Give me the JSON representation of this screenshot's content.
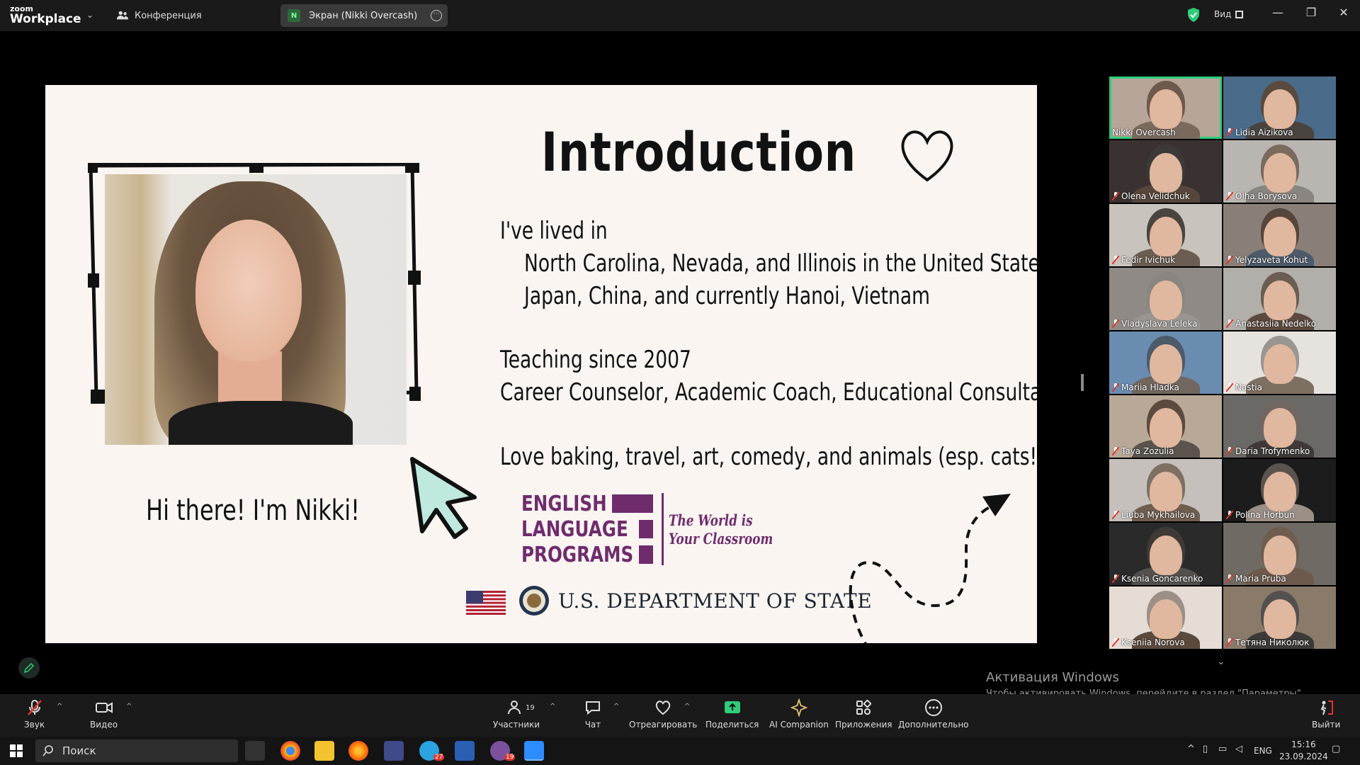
{
  "titlebar": {
    "logo_top": "zoom",
    "logo_bottom": "Workplace",
    "conference_label": "Конференция",
    "screen_tab_badge": "N",
    "screen_tab_label": "Экран (Nikki Overcash)",
    "view_label": "Вид"
  },
  "slide": {
    "title": "Introduction",
    "lived_heading": "I've lived in",
    "lived_line1": "North Carolina, Nevada, and Illinois in the United States",
    "lived_line2": "Japan, China, and currently Hanoi, Vietnam",
    "teaching": "Teaching since 2007",
    "roles": "Career Counselor, Academic Coach, Educational Consultant",
    "hobbies": "Love baking, travel, art, comedy, and animals (esp. cats!)",
    "greeting": "Hi there! I'm Nikki!",
    "elp_line1": "ENGLISH",
    "elp_line2": "LANGUAGE",
    "elp_line3": "PROGRAMS",
    "elp_tagline1": "The World is",
    "elp_tagline2": "Your Classroom",
    "dos": "U.S. DEPARTMENT OF STATE"
  },
  "participants": [
    {
      "name": "Nikki Overcash",
      "muted": false,
      "active": true
    },
    {
      "name": "Lidia Aizikova",
      "muted": true
    },
    {
      "name": "Olena Velidchuk",
      "muted": true
    },
    {
      "name": "Olha Borysova",
      "muted": true
    },
    {
      "name": "Fedir Ivichuk",
      "muted": true
    },
    {
      "name": "Yelyzaveta Kohut",
      "muted": true
    },
    {
      "name": "Vladyslava Leleka",
      "muted": true
    },
    {
      "name": "Anastasiia Nedelko",
      "muted": true
    },
    {
      "name": "Mariia Hladka",
      "muted": true
    },
    {
      "name": "Nastia",
      "muted": true
    },
    {
      "name": "Taya Zozulia",
      "muted": true
    },
    {
      "name": "Daria Trofymenko",
      "muted": true
    },
    {
      "name": "Liuba Mykhailova",
      "muted": true
    },
    {
      "name": "Polina Horbun",
      "muted": true
    },
    {
      "name": "Ksenia Goncarenko",
      "muted": true
    },
    {
      "name": "Maria Pruba",
      "muted": true
    },
    {
      "name": "Kseniia Norova",
      "muted": true
    },
    {
      "name": "Тетяна Николюк",
      "muted": true
    }
  ],
  "activation": {
    "line1": "Активация Windows",
    "line2": "Чтобы активировать Windows, перейдите в раздел \"Параметры\"."
  },
  "toolbar": {
    "audio": "Звук",
    "video": "Видео",
    "participants": "Участники",
    "participants_count": "19",
    "chat": "Чат",
    "react": "Отреагировать",
    "share": "Поделиться",
    "ai": "AI Companion",
    "apps": "Приложения",
    "more": "Дополнительно",
    "leave": "Выйти"
  },
  "taskbar": {
    "search": "Поиск",
    "lang": "ENG",
    "time": "15:16",
    "date": "23.09.2024",
    "telegram_badge": "27",
    "viber_badge": "19"
  },
  "colors": {
    "accent_green": "#2fcc7a",
    "elp_purple": "#6f2c6d",
    "slide_bg": "#fbf5f2",
    "mute_red": "#e0352b"
  }
}
